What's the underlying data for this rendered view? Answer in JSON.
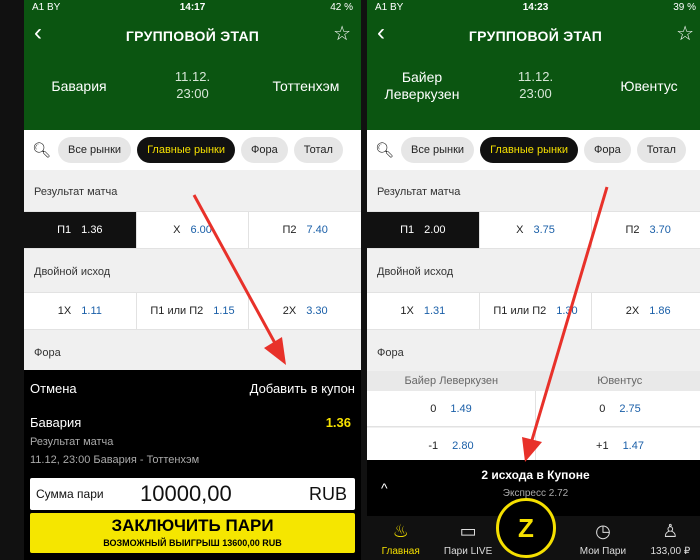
{
  "left": {
    "status": {
      "carrier": "A1 BY",
      "time": "14:17",
      "battery": "42 %"
    },
    "header": {
      "title": "ГРУППОВОЙ ЭТАП",
      "home": "Бавария",
      "away": "Тоттенхэм",
      "date": "11.12.",
      "time": "23:00"
    },
    "tabs": [
      "Все рынки",
      "Главные рынки",
      "Фора",
      "Тотал"
    ],
    "result": {
      "label": "Результат матча",
      "cells": [
        {
          "k": "П1",
          "v": "1.36"
        },
        {
          "k": "X",
          "v": "6.00"
        },
        {
          "k": "П2",
          "v": "7.40"
        }
      ]
    },
    "double": {
      "label": "Двойной исход",
      "cells": [
        {
          "k": "1X",
          "v": "1.11"
        },
        {
          "k": "П1 или П2",
          "v": "1.15"
        },
        {
          "k": "2X",
          "v": "3.30"
        }
      ]
    },
    "fora_label": "Фора",
    "sheet": {
      "cancel": "Отмена",
      "add": "Добавить в купон",
      "team": "Бавария",
      "odd": "1.36",
      "market": "Результат матча",
      "info": "11.12, 23:00 Бавария - Тоттенхэм",
      "stake_label": "Сумма пари",
      "stake_value": "10000,00",
      "currency": "RUB",
      "place": "ЗАКЛЮЧИТЬ ПАРИ",
      "win": "ВОЗМОЖНЫЙ ВЫИГРЫШ 13600,00 RUB"
    }
  },
  "right": {
    "status": {
      "carrier": "A1 BY",
      "time": "14:23",
      "battery": "39 %"
    },
    "header": {
      "title": "ГРУППОВОЙ ЭТАП",
      "home": "Байер Леверкузен",
      "away": "Ювентус",
      "date": "11.12.",
      "time": "23:00"
    },
    "tabs": [
      "Все рынки",
      "Главные рынки",
      "Фора",
      "Тотал"
    ],
    "result": {
      "label": "Результат матча",
      "cells": [
        {
          "k": "П1",
          "v": "2.00"
        },
        {
          "k": "X",
          "v": "3.75"
        },
        {
          "k": "П2",
          "v": "3.70"
        }
      ]
    },
    "double": {
      "label": "Двойной исход",
      "cells": [
        {
          "k": "1X",
          "v": "1.31"
        },
        {
          "k": "П1 или П2",
          "v": "1.30"
        },
        {
          "k": "2X",
          "v": "1.86"
        }
      ]
    },
    "fora": {
      "label": "Фора",
      "home": "Байер Леверкузен",
      "away": "Ювентус",
      "rows": [
        {
          "h": "0",
          "hv": "1.49",
          "a": "0",
          "av": "2.75"
        },
        {
          "h": "-1",
          "hv": "2.80",
          "a": "+1",
          "av": "1.47"
        }
      ]
    },
    "coupon": {
      "title": "2 исхода в Купоне",
      "express": "Экспресс 2.72"
    },
    "nav": [
      "Главная",
      "Пари LIVE",
      "Мои Пари",
      "133,00 ₽"
    ]
  },
  "colors": {
    "green": "#0b5511",
    "yellow": "#f5e000",
    "odds": "#1a5fa8",
    "arrow": "#e8312a"
  },
  "icons": {
    "back": "chevron-left-icon",
    "star": "star-icon",
    "search": "search-icon"
  }
}
